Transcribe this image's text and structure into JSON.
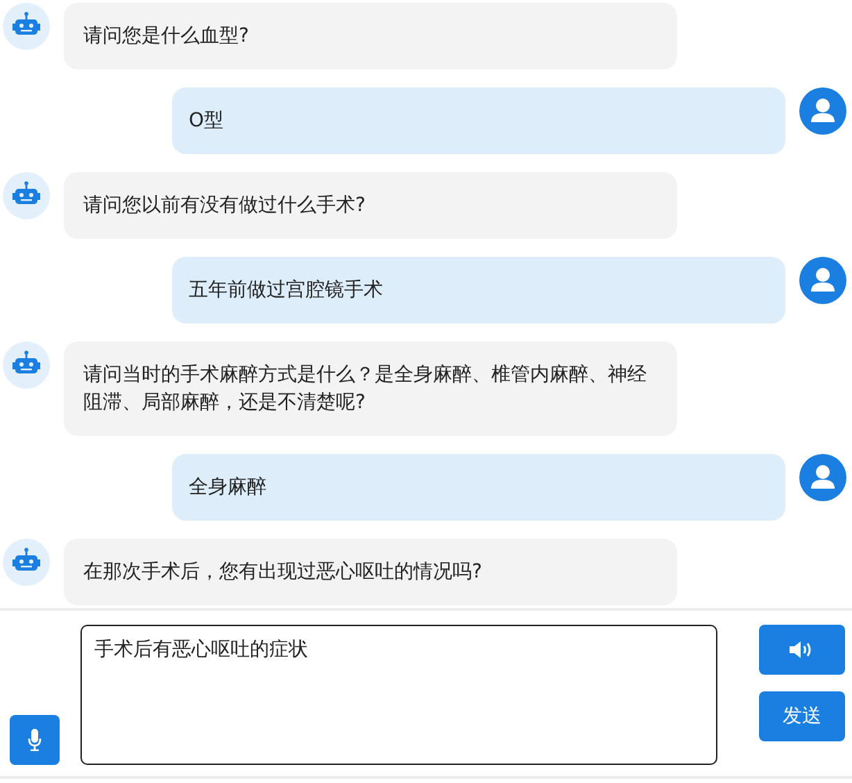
{
  "messages": [
    {
      "kind": "bot",
      "text": "请问您是什么血型?"
    },
    {
      "kind": "user",
      "text": "O型"
    },
    {
      "kind": "bot",
      "text": "请问您以前有没有做过什么手术?"
    },
    {
      "kind": "user",
      "text": "五年前做过宫腔镜手术"
    },
    {
      "kind": "bot",
      "text": "请问当时的手术麻醉方式是什么？是全身麻醉、椎管内麻醉、神经阻滞、局部麻醉，还是不清楚呢?"
    },
    {
      "kind": "user",
      "text": "全身麻醉"
    },
    {
      "kind": "bot",
      "text": "在那次手术后，您有出现过恶心呕吐的情况吗?"
    }
  ],
  "composer": {
    "value": "手术后有恶心呕吐的症状",
    "send_label": "发送"
  }
}
